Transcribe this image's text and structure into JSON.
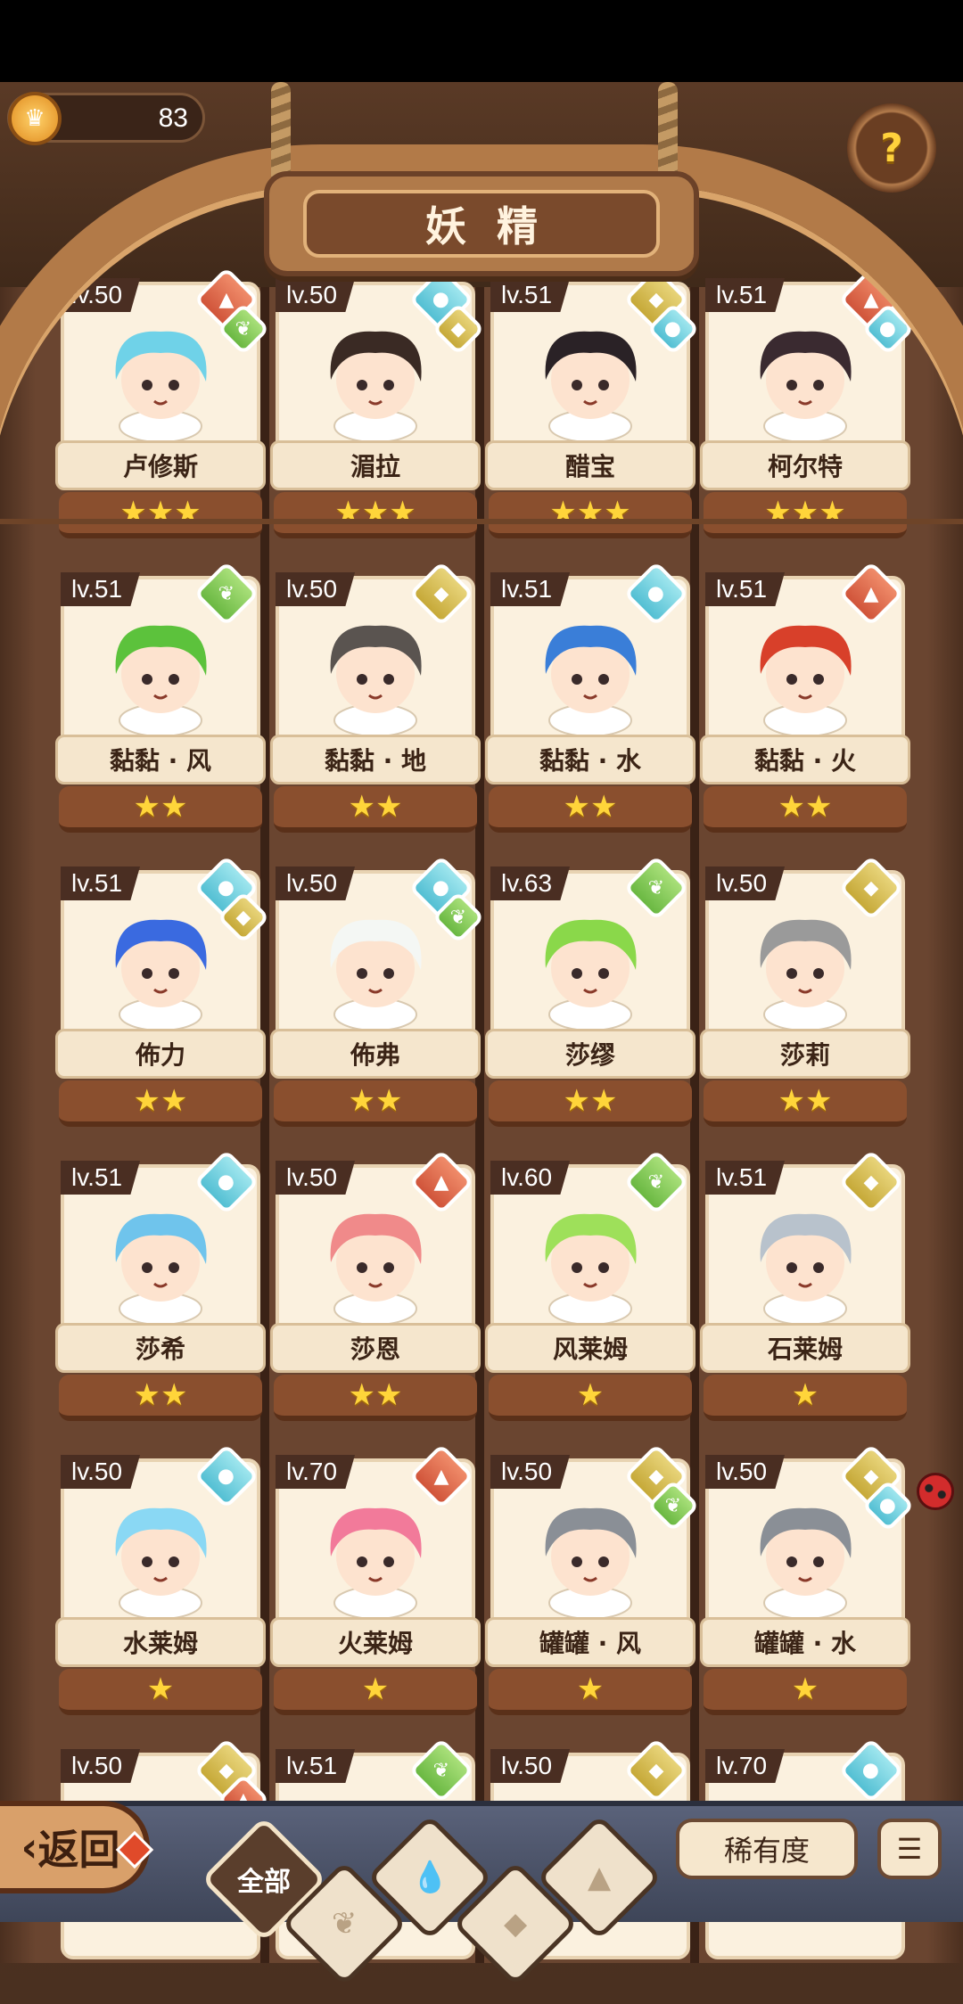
{
  "header": {
    "title": "妖精",
    "coins": "83"
  },
  "fairies": [
    {
      "level": "lv.50",
      "name": "卢修斯",
      "stars": "★★★",
      "elements": [
        "fire",
        "wind"
      ]
    },
    {
      "level": "lv.50",
      "name": "湄拉",
      "stars": "★★★",
      "elements": [
        "water",
        "earth"
      ]
    },
    {
      "level": "lv.51",
      "name": "醋宝",
      "stars": "★★★",
      "elements": [
        "earth",
        "water"
      ]
    },
    {
      "level": "lv.51",
      "name": "柯尔特",
      "stars": "★★★",
      "elements": [
        "fire",
        "water"
      ]
    },
    {
      "level": "lv.51",
      "name": "黏黏 · 风",
      "stars": "★★",
      "elements": [
        "wind"
      ]
    },
    {
      "level": "lv.50",
      "name": "黏黏 · 地",
      "stars": "★★",
      "elements": [
        "earth"
      ]
    },
    {
      "level": "lv.51",
      "name": "黏黏 · 水",
      "stars": "★★",
      "elements": [
        "water"
      ]
    },
    {
      "level": "lv.51",
      "name": "黏黏 · 火",
      "stars": "★★",
      "elements": [
        "fire"
      ]
    },
    {
      "level": "lv.51",
      "name": "佈力",
      "stars": "★★",
      "elements": [
        "water",
        "earth"
      ]
    },
    {
      "level": "lv.50",
      "name": "佈弗",
      "stars": "★★",
      "elements": [
        "water",
        "wind"
      ]
    },
    {
      "level": "lv.63",
      "name": "莎缪",
      "stars": "★★",
      "elements": [
        "wind"
      ]
    },
    {
      "level": "lv.50",
      "name": "莎莉",
      "stars": "★★",
      "elements": [
        "earth"
      ]
    },
    {
      "level": "lv.51",
      "name": "莎希",
      "stars": "★★",
      "elements": [
        "water"
      ]
    },
    {
      "level": "lv.50",
      "name": "莎恩",
      "stars": "★★",
      "elements": [
        "fire"
      ]
    },
    {
      "level": "lv.60",
      "name": "风莱姆",
      "stars": "★",
      "elements": [
        "wind"
      ]
    },
    {
      "level": "lv.51",
      "name": "石莱姆",
      "stars": "★",
      "elements": [
        "earth"
      ]
    },
    {
      "level": "lv.50",
      "name": "水莱姆",
      "stars": "★",
      "elements": [
        "water"
      ]
    },
    {
      "level": "lv.70",
      "name": "火莱姆",
      "stars": "★",
      "elements": [
        "fire"
      ]
    },
    {
      "level": "lv.50",
      "name": "罐罐 · 风",
      "stars": "★",
      "elements": [
        "earth",
        "wind"
      ]
    },
    {
      "level": "lv.50",
      "name": "罐罐 · 水",
      "stars": "★",
      "elements": [
        "earth",
        "water"
      ]
    },
    {
      "level": "lv.50",
      "name": "",
      "stars": "",
      "elements": [
        "earth",
        "fire"
      ]
    },
    {
      "level": "lv.51",
      "name": "",
      "stars": "",
      "elements": [
        "wind"
      ]
    },
    {
      "level": "lv.50",
      "name": "",
      "stars": "",
      "elements": [
        "earth"
      ]
    },
    {
      "level": "lv.70",
      "name": "",
      "stars": "",
      "elements": [
        "water"
      ]
    }
  ],
  "element_colors": {
    "fire": "#d0543a",
    "water": "#53bfd3",
    "wind": "#6ab842",
    "earth": "#c6a938"
  },
  "bottom": {
    "back_label": "返回",
    "tab_all": "全部",
    "rarity_label": "稀有度"
  }
}
